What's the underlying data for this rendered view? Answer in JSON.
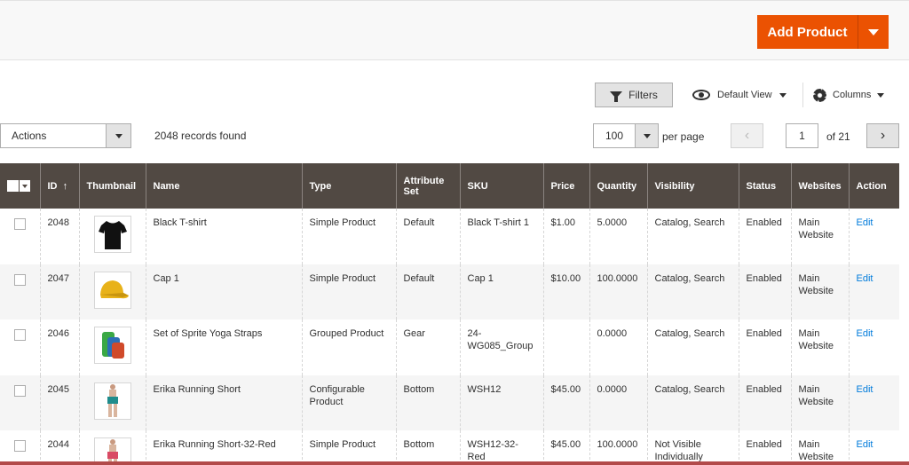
{
  "header": {
    "add_product_label": "Add Product"
  },
  "toolbar": {
    "filters_label": "Filters",
    "view_label": "Default View",
    "columns_label": "Columns",
    "actions_label": "Actions",
    "records_found": "2048 records found",
    "per_page_value": "100",
    "per_page_label": "per page",
    "current_page": "1",
    "of_pages": "of 21",
    "prev_symbol": "‹",
    "next_symbol": "›"
  },
  "columns": [
    "ID",
    "Thumbnail",
    "Name",
    "Type",
    "Attribute Set",
    "SKU",
    "Price",
    "Quantity",
    "Visibility",
    "Status",
    "Websites",
    "Action"
  ],
  "sort_indicator": "↑",
  "rows": [
    {
      "id": "2048",
      "thumb_icon": "tshirt-icon",
      "name": "Black T-shirt",
      "type": "Simple Product",
      "attribute_set": "Default",
      "sku": "Black T-shirt 1",
      "price": "$1.00",
      "quantity": "5.0000",
      "visibility": "Catalog, Search",
      "status": "Enabled",
      "websites": "Main Website",
      "action": "Edit"
    },
    {
      "id": "2047",
      "thumb_icon": "cap-icon",
      "name": "Cap 1",
      "type": "Simple Product",
      "attribute_set": "Default",
      "sku": "Cap 1",
      "price": "$10.00",
      "quantity": "100.0000",
      "visibility": "Catalog, Search",
      "status": "Enabled",
      "websites": "Main Website",
      "action": "Edit"
    },
    {
      "id": "2046",
      "thumb_icon": "yoga-straps-icon",
      "name": "Set of Sprite Yoga Straps",
      "type": "Grouped Product",
      "attribute_set": "Gear",
      "sku": "24-WG085_Group",
      "price": "",
      "quantity": "0.0000",
      "visibility": "Catalog, Search",
      "status": "Enabled",
      "websites": "Main Website",
      "action": "Edit"
    },
    {
      "id": "2045",
      "thumb_icon": "running-short-icon",
      "name": "Erika Running Short",
      "type": "Configurable Product",
      "attribute_set": "Bottom",
      "sku": "WSH12",
      "price": "$45.00",
      "quantity": "0.0000",
      "visibility": "Catalog, Search",
      "status": "Enabled",
      "websites": "Main Website",
      "action": "Edit"
    },
    {
      "id": "2044",
      "thumb_icon": "running-short-red-icon",
      "name": "Erika Running Short-32-Red",
      "type": "Simple Product",
      "attribute_set": "Bottom",
      "sku": "WSH12-32-Red",
      "price": "$45.00",
      "quantity": "100.0000",
      "visibility": "Not Visible Individually",
      "status": "Enabled",
      "websites": "Main Website",
      "action": "Edit"
    }
  ],
  "colors": {
    "accent": "#eb5202",
    "header_bg": "#514943",
    "link": "#007bdb"
  }
}
